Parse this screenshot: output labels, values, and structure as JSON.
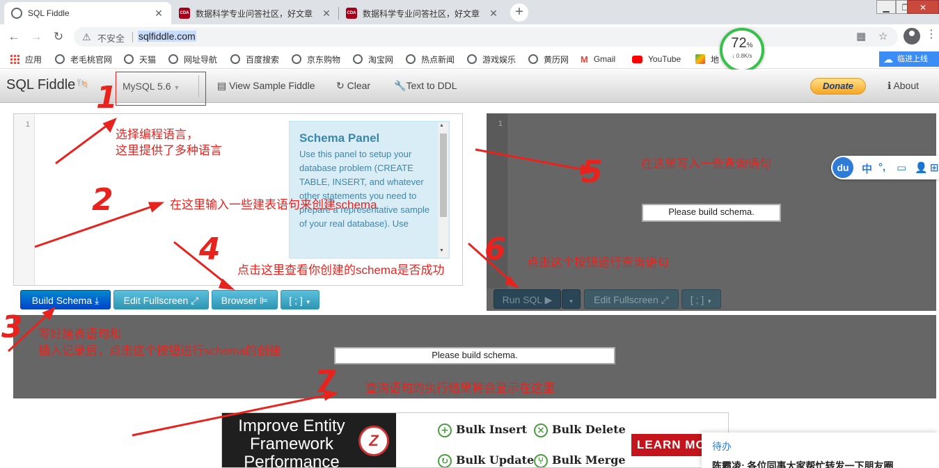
{
  "browser": {
    "tabs": [
      {
        "title": "SQL Fiddle",
        "active": true
      },
      {
        "title": "数据科学专业问答社区，好文章",
        "active": false,
        "favicon": "CDA"
      },
      {
        "title": "数据科学专业问答社区，好文章",
        "active": false,
        "favicon": "CDA"
      }
    ],
    "insecure_label": "不安全",
    "url": "sqlfiddle.com",
    "bookmarks": [
      "应用",
      "老毛桃官网",
      "天猫",
      "网址导航",
      "百度搜索",
      "京东购物",
      "淘宝网",
      "热点新闻",
      "游戏娱乐",
      "黄历网",
      "Gmail",
      "YouTube",
      "地"
    ],
    "cloud_button": "临进上线"
  },
  "speed_widget": {
    "percent": "72",
    "percent_sign": "%",
    "rate": "↓ 0.8K/s"
  },
  "fiddle": {
    "brand": "SQL Fiddle",
    "db_select": "MySQL 5.6",
    "nav": {
      "view_sample": "View Sample Fiddle",
      "clear": "Clear",
      "text_to_ddl": "Text to DDL",
      "donate": "Donate",
      "about": "About"
    },
    "schema_line_no": "1",
    "schema_panel": {
      "title": "Schema Panel",
      "body": "Use this panel to setup your database problem (CREATE TABLE, INSERT, and whatever other statements you need to prepare a representative sample of your real database). Use"
    },
    "query_line_no": "1",
    "please_build": "Please build schema.",
    "buttons": {
      "build_schema": "Build Schema",
      "edit_fullscreen": "Edit Fullscreen",
      "browser": "Browser",
      "terminator": "[ ; ]",
      "run_sql": "Run SQL",
      "edit_fullscreen_right": "Edit Fullscreen",
      "terminator_right": "[ ; ]"
    },
    "results_please_build": "Please build schema."
  },
  "ad": {
    "title": "Improve Entity Framework Performance",
    "items": [
      "Bulk Insert",
      "Bulk Delete",
      "Bulk Update",
      "Bulk Merge"
    ],
    "cta": "LEARN MOR"
  },
  "notification": {
    "title": "待办",
    "text": "陈霸凌: 各位同事大家帮忙转发一下朋友圈"
  },
  "ime": {
    "logo": "du",
    "items": [
      "中",
      "°,",
      "▭",
      "👤",
      "⊞"
    ]
  },
  "annotations": {
    "n1": "1",
    "n2": "2",
    "n3": "3",
    "n4": "4",
    "n5": "5",
    "n6": "6",
    "n7": "7",
    "t1a": "选择编程语言，",
    "t1b": "这里提供了多种语言",
    "t2": "在这里输入一些建表语句来创建schema",
    "t3a": "写好建表语句和",
    "t3b": "插入记录后，点击这个按钮进行schema的创建",
    "t4": "点击这里查看你创建的schema是否成功",
    "t5": "在这里写入一些查询语句",
    "t6": "点击这个按钮运行查询语句",
    "t7": "查询语句的执行结果将会显示在这里"
  },
  "colors": {
    "annotation": "#e8231e",
    "build_button": "#0055cc",
    "panel_text": "#3a87ad",
    "editor_dark": "#666666"
  }
}
